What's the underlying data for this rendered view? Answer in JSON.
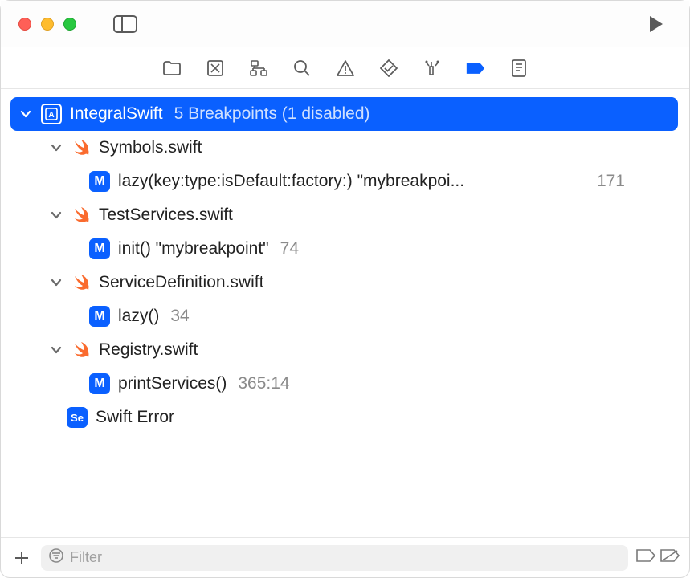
{
  "project": {
    "name": "IntegralSwift",
    "summary": "5 Breakpoints (1 disabled)"
  },
  "files": [
    {
      "name": "Symbols.swift",
      "items": [
        {
          "label": "lazy(key:type:isDefault:factory:) \"mybreakpoi...",
          "line": "171",
          "enabled": true
        }
      ]
    },
    {
      "name": "TestServices.swift",
      "items": [
        {
          "label": "init() \"mybreakpoint\"",
          "line": "74",
          "enabled": true
        }
      ]
    },
    {
      "name": "ServiceDefinition.swift",
      "items": [
        {
          "label": "lazy()",
          "line": "34",
          "enabled": false
        }
      ]
    },
    {
      "name": "Registry.swift",
      "items": [
        {
          "label": "printServices()",
          "line": "365:14",
          "enabled": true
        }
      ]
    }
  ],
  "extra": {
    "swift_error": "Swift Error"
  },
  "filter": {
    "placeholder": "Filter"
  }
}
